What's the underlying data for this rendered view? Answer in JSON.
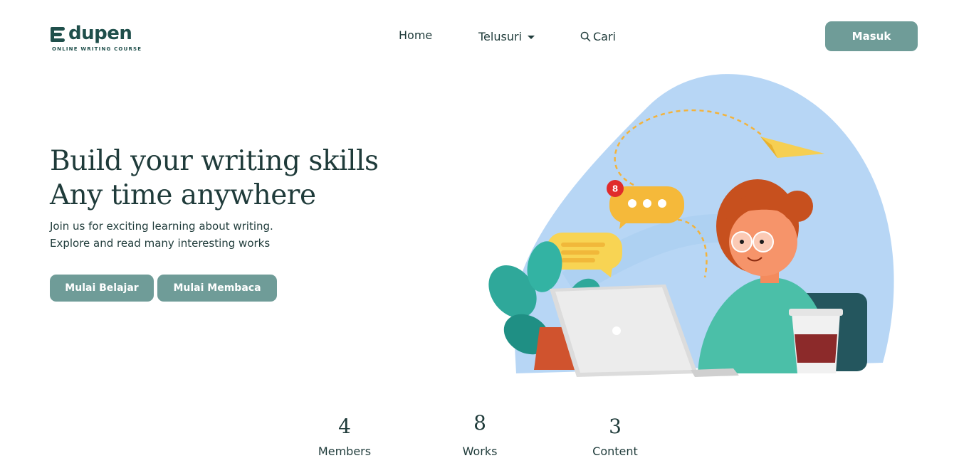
{
  "brand": {
    "name": "dupen",
    "tagline": "ONLINE WRITING COURSE",
    "color": "#1f4f4b"
  },
  "nav": {
    "home": "Home",
    "explore": "Telusuri",
    "search": "Cari",
    "login": "Masuk"
  },
  "hero": {
    "title_line1": "Build your writing skills",
    "title_line2": "Any time anywhere",
    "subtitle_line1": "Join us for exciting learning about writing.",
    "subtitle_line2": "Explore and read many interesting works",
    "btn_learn": "Mulai Belajar",
    "btn_read": "Mulai Membaca",
    "notification_count": "8"
  },
  "stats": [
    {
      "value": "4",
      "label": "Members"
    },
    {
      "value": "8",
      "label": "Works"
    },
    {
      "value": "3",
      "label": "Content"
    }
  ],
  "colors": {
    "accent": "#6f9c98",
    "text": "#1f3b3a",
    "blob": "#b7d6f5"
  }
}
